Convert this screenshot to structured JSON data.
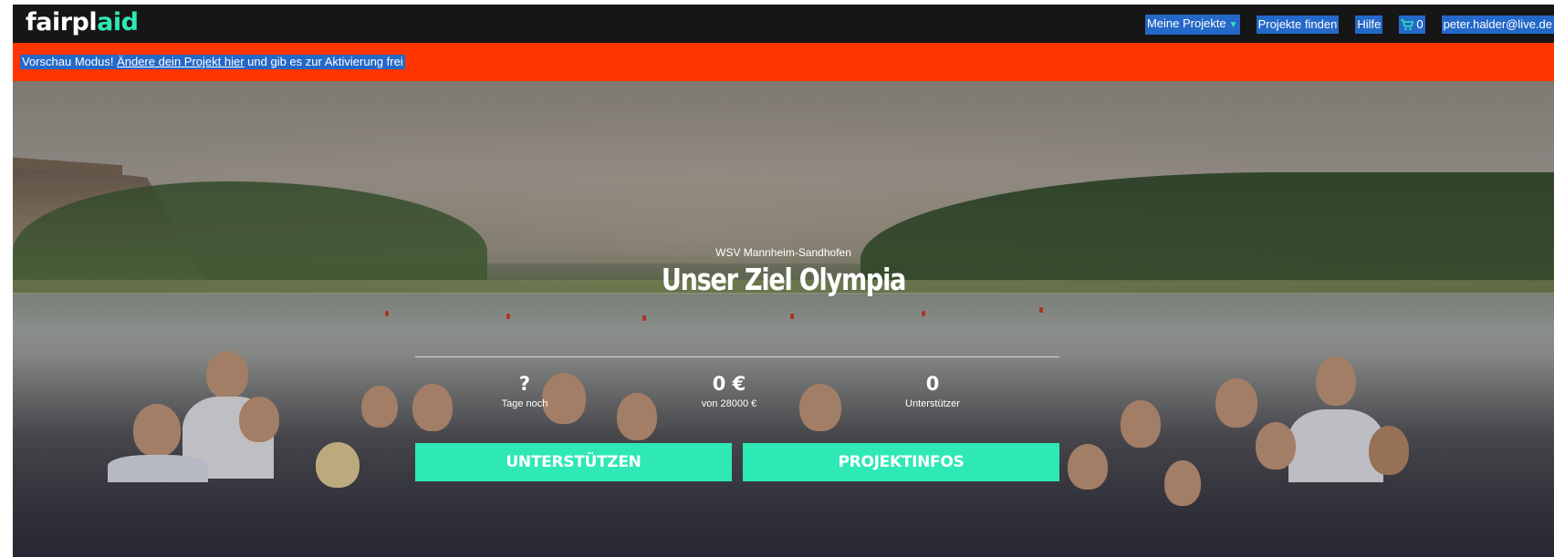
{
  "logo": {
    "prefix": "fairpl",
    "accent": "aid"
  },
  "nav": {
    "my_projects": "Meine Projekte",
    "find_projects": "Projekte finden",
    "help": "Hilfe",
    "cart_count": "0",
    "user_email": "peter.halder@live.de"
  },
  "banner": {
    "prefix": "Vorschau Modus! ",
    "link": "Ändere dein Projekt hier",
    "suffix": " und gib es zur Aktivierung frei"
  },
  "hero": {
    "organization": "WSV Mannheim-Sandhofen",
    "title": "Unser Ziel Olympia",
    "stats": [
      {
        "value": "?",
        "label": "Tage noch"
      },
      {
        "value": "0 €",
        "label": "von 28000 €"
      },
      {
        "value": "0",
        "label": "Unterstützer"
      }
    ],
    "buttons": {
      "support": "UNTERSTÜTZEN",
      "info": "PROJEKTINFOS"
    }
  },
  "colors": {
    "accent": "#2ee8b6",
    "banner": "#ff3500",
    "topbar": "#161616",
    "selection": "#2468c8"
  },
  "icons": {
    "cart": "cart-icon",
    "caret": "caret-down-icon"
  }
}
